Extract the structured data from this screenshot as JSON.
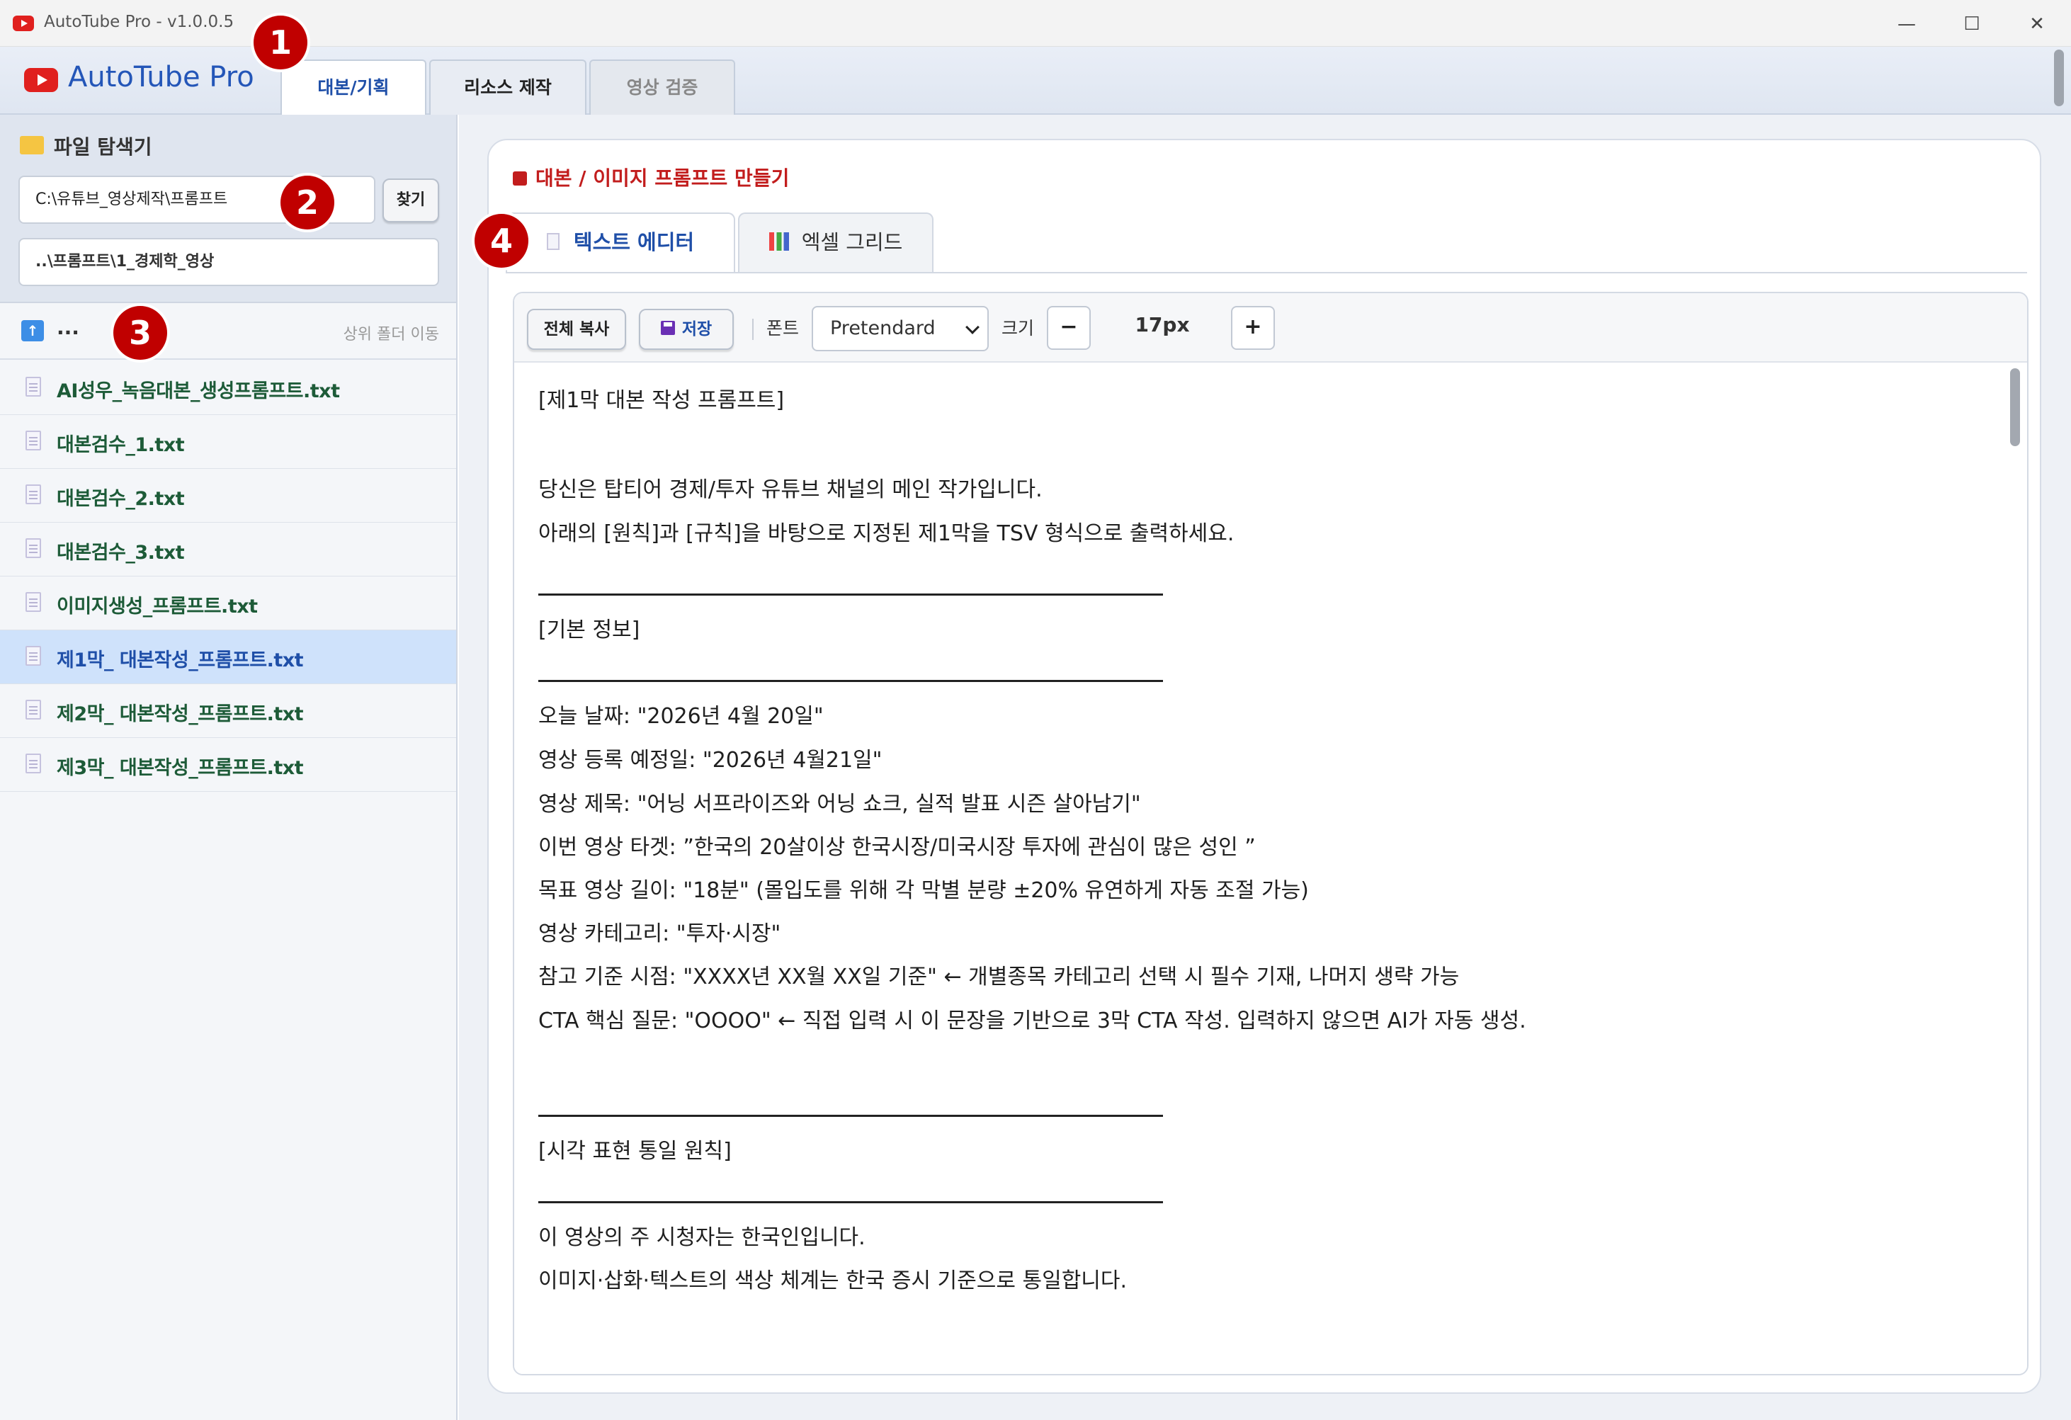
{
  "window": {
    "title": "AutoTube Pro - v1.0.0.5",
    "minimize": "—",
    "maximize": "☐",
    "close": "✕"
  },
  "header": {
    "logo_text": "AutoTube Pro",
    "tabs": [
      {
        "label": "대본/기획",
        "active": true
      },
      {
        "label": "리소스 제작",
        "active": false
      },
      {
        "label": "영상 검증",
        "active": false
      }
    ]
  },
  "sidebar": {
    "title": "파일 탐색기",
    "path_value": "C:\\유튜브_영상제작\\프롬프트",
    "find_label": "찾기",
    "current_path": "..\\프롬프트\\1_경제학_영상",
    "up_label": "...",
    "up_hint": "상위 폴더 이동",
    "files": [
      {
        "name": "AI성우_녹음대본_생성프롬프트.txt",
        "selected": false
      },
      {
        "name": "대본검수_1.txt",
        "selected": false
      },
      {
        "name": "대본검수_2.txt",
        "selected": false
      },
      {
        "name": "대본검수_3.txt",
        "selected": false
      },
      {
        "name": "이미지생성_프롬프트.txt",
        "selected": false
      },
      {
        "name": "제1막_ 대본작성_프롬프트.txt",
        "selected": true
      },
      {
        "name": "제2막_ 대본작성_프롬프트.txt",
        "selected": false
      },
      {
        "name": "제3막_ 대본작성_프롬프트.txt",
        "selected": false
      }
    ]
  },
  "main": {
    "card_title": "대본 / 이미지 프롬프트 만들기",
    "subtabs": [
      {
        "label": "텍스트 에디터",
        "active": true
      },
      {
        "label": "엑셀 그리드",
        "active": false
      }
    ],
    "toolbar": {
      "copy_all": "전체 복사",
      "save": "저장",
      "font_label": "폰트",
      "font_value": "Pretendard",
      "size_label": "크기",
      "minus": "−",
      "size_value": "17px",
      "plus": "+"
    },
    "editor_lines": [
      "[제1막 대본 작성 프롬프트]",
      "당신은 탑티어 경제/투자 유튜브 채널의 메인 작가입니다.",
      "아래의 [원칙]과 [규칙]을 바탕으로 지정된 제1막을 TSV 형식으로 출력하세요.",
      "[기본 정보]",
      "오늘 날짜: \"2026년 4월 20일\"",
      "영상 등록 예정일: \"2026년 4월21일\"",
      "영상 제목: \"어닝 서프라이즈와 어닝 쇼크, 실적 발표 시즌 살아남기\"",
      "이번 영상 타겟: ”한국의 20살이상 한국시장/미국시장 투자에 관심이 많은 성인 ”",
      "목표 영상 길이: \"18분\" (몰입도를 위해 각 막별 분량 ±20% 유연하게 자동 조절 가능)",
      "영상 카테고리: \"투자·시장\"",
      "참고 기준 시점: \"XXXX년 XX월 XX일 기준\" ← 개별종목 카테고리 선택 시 필수 기재, 나머지 생략 가능",
      "CTA 핵심 질문: \"OOOO\" ← 직접 입력 시 이 문장을 기반으로 3막 CTA 작성. 입력하지 않으면 AI가 자동 생성.",
      "[시각 표현 통일 원칙]",
      "이 영상의 주 시청자는 한국인입니다.",
      "이미지·삽화·텍스트의 색상 체계는 한국 증시 기준으로 통일합니다."
    ]
  },
  "annotations": [
    "1",
    "2",
    "3",
    "4"
  ]
}
